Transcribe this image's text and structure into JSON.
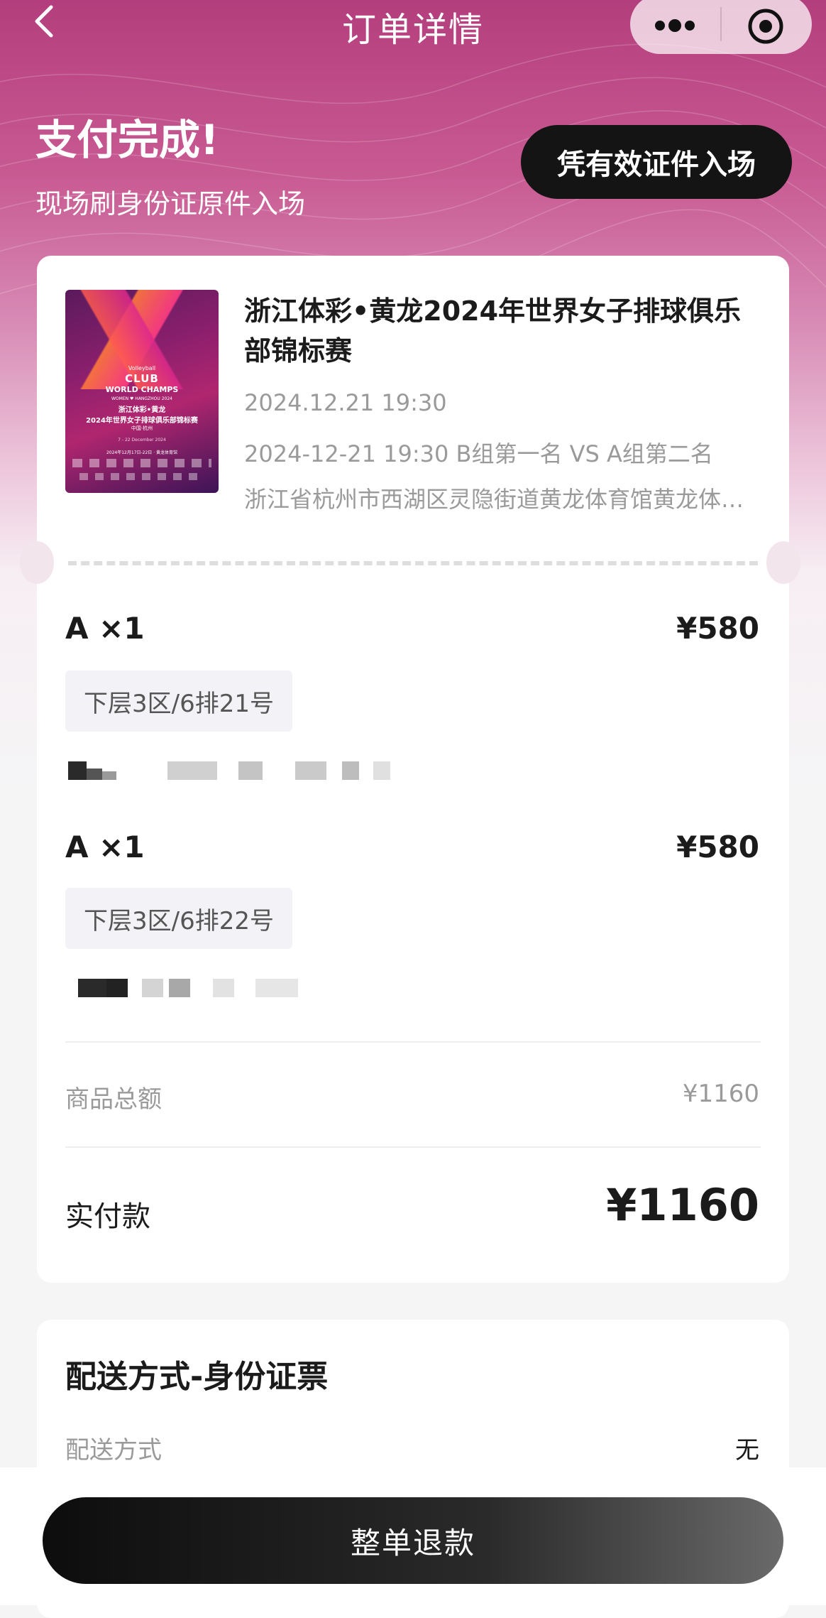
{
  "nav": {
    "title": "订单详情",
    "back_icon": "chevron-left-icon",
    "more_icon": "more-dots-icon",
    "close_icon": "target-circle-icon"
  },
  "status": {
    "title": "支付完成!",
    "subtitle": "现场刷身份证原件入场",
    "entry_button": "凭有效证件入场"
  },
  "event": {
    "title": "浙江体彩•黄龙2024年世界女子排球俱乐部锦标赛",
    "date": "2024.12.21 19:30",
    "session": "2024-12-21 19:30 B组第一名 VS A组第二名",
    "venue": "浙江省杭州市西湖区灵隐街道黄龙体育馆黄龙体育中心",
    "poster": {
      "brand": "Volleyball",
      "line1": "CLUB",
      "line2": "WORLD CHAMPS",
      "line3": "WOMEN ♥ HANGZHOU 2024",
      "line4": "浙江体彩•黄龙",
      "line5": "2024年世界女子排球俱乐部锦标赛",
      "line6": "中国·杭州",
      "line7": "7 - 22 December 2024",
      "line8": "2024年12月17日-22日 · 黄龙体育馆"
    }
  },
  "tickets": [
    {
      "name": "A ×1",
      "price": "¥580",
      "seat": "下层3区/6排21号"
    },
    {
      "name": "A ×1",
      "price": "¥580",
      "seat": "下层3区/6排22号"
    }
  ],
  "summary": {
    "subtotal_label": "商品总额",
    "subtotal_value": "¥1160",
    "paid_label": "实付款",
    "paid_value": "¥1160"
  },
  "delivery": {
    "title": "配送方式-身份证票",
    "method_label": "配送方式",
    "method_value": "无"
  },
  "actions": {
    "refund_button": "整单退款"
  },
  "colors": {
    "header_gradient_top": "#b43e7d",
    "primary_button": "#141414",
    "muted_text": "#9a9a9a"
  }
}
